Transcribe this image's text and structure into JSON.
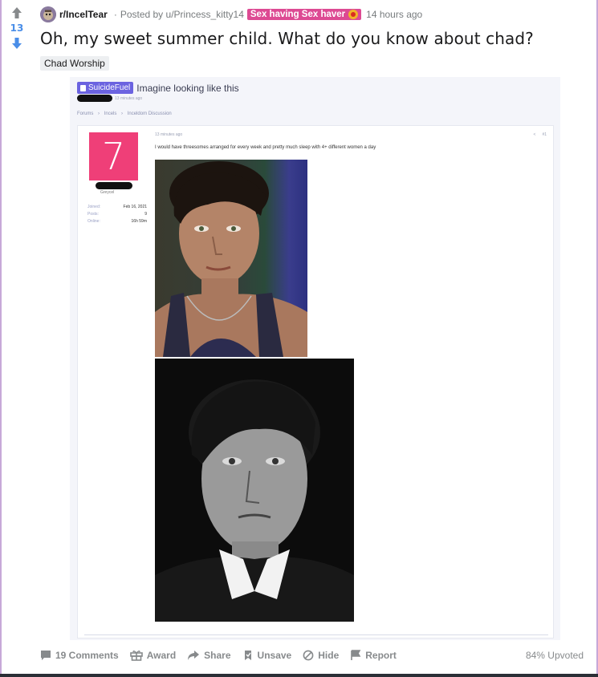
{
  "post": {
    "vote_count": "13",
    "subreddit": "r/IncelTear",
    "posted_by": "Posted by u/Princess_kitty14",
    "user_flair": "Sex having Sex haver",
    "timestamp": "14 hours ago",
    "title": "Oh, my sweet summer child. What do you know about chad?",
    "link_flair": "Chad Worship"
  },
  "embedded": {
    "site_badge": "SuicideFuel",
    "thread_title": "Imagine looking like this",
    "meta_time": "13 minutes ago",
    "crumbs": [
      "Forums",
      "Incels",
      "Inceldom Discussion"
    ],
    "avatar_letter": "7",
    "user_role": "Greycel",
    "stats": [
      {
        "label": "Joined:",
        "value": "Feb 16, 2021"
      },
      {
        "label": "Posts:",
        "value": "9"
      },
      {
        "label": "Online:",
        "value": "16h 59m"
      }
    ],
    "post_time": "13 minutes ago",
    "post_number": "#1",
    "post_text": "I would have threesomes arranged for every week and pretty much sleep with 4+ different women a day"
  },
  "actions": {
    "comments": "19 Comments",
    "award": "Award",
    "share": "Share",
    "unsave": "Unsave",
    "hide": "Hide",
    "report": "Report",
    "upvoted": "84% Upvoted"
  },
  "colors": {
    "upvote": "#878a8c",
    "downvote": "#4a8ee8",
    "vote_count": "#4a8ee8",
    "user_flair_bg": "#dd4a93",
    "site_badge_bg": "#6b63e0",
    "avatar_bg": "#ef3f78"
  },
  "icons": [
    "upvote-arrow-icon",
    "downvote-arrow-icon",
    "comment-icon",
    "award-icon",
    "share-icon",
    "unsave-icon",
    "hide-icon",
    "report-icon"
  ]
}
